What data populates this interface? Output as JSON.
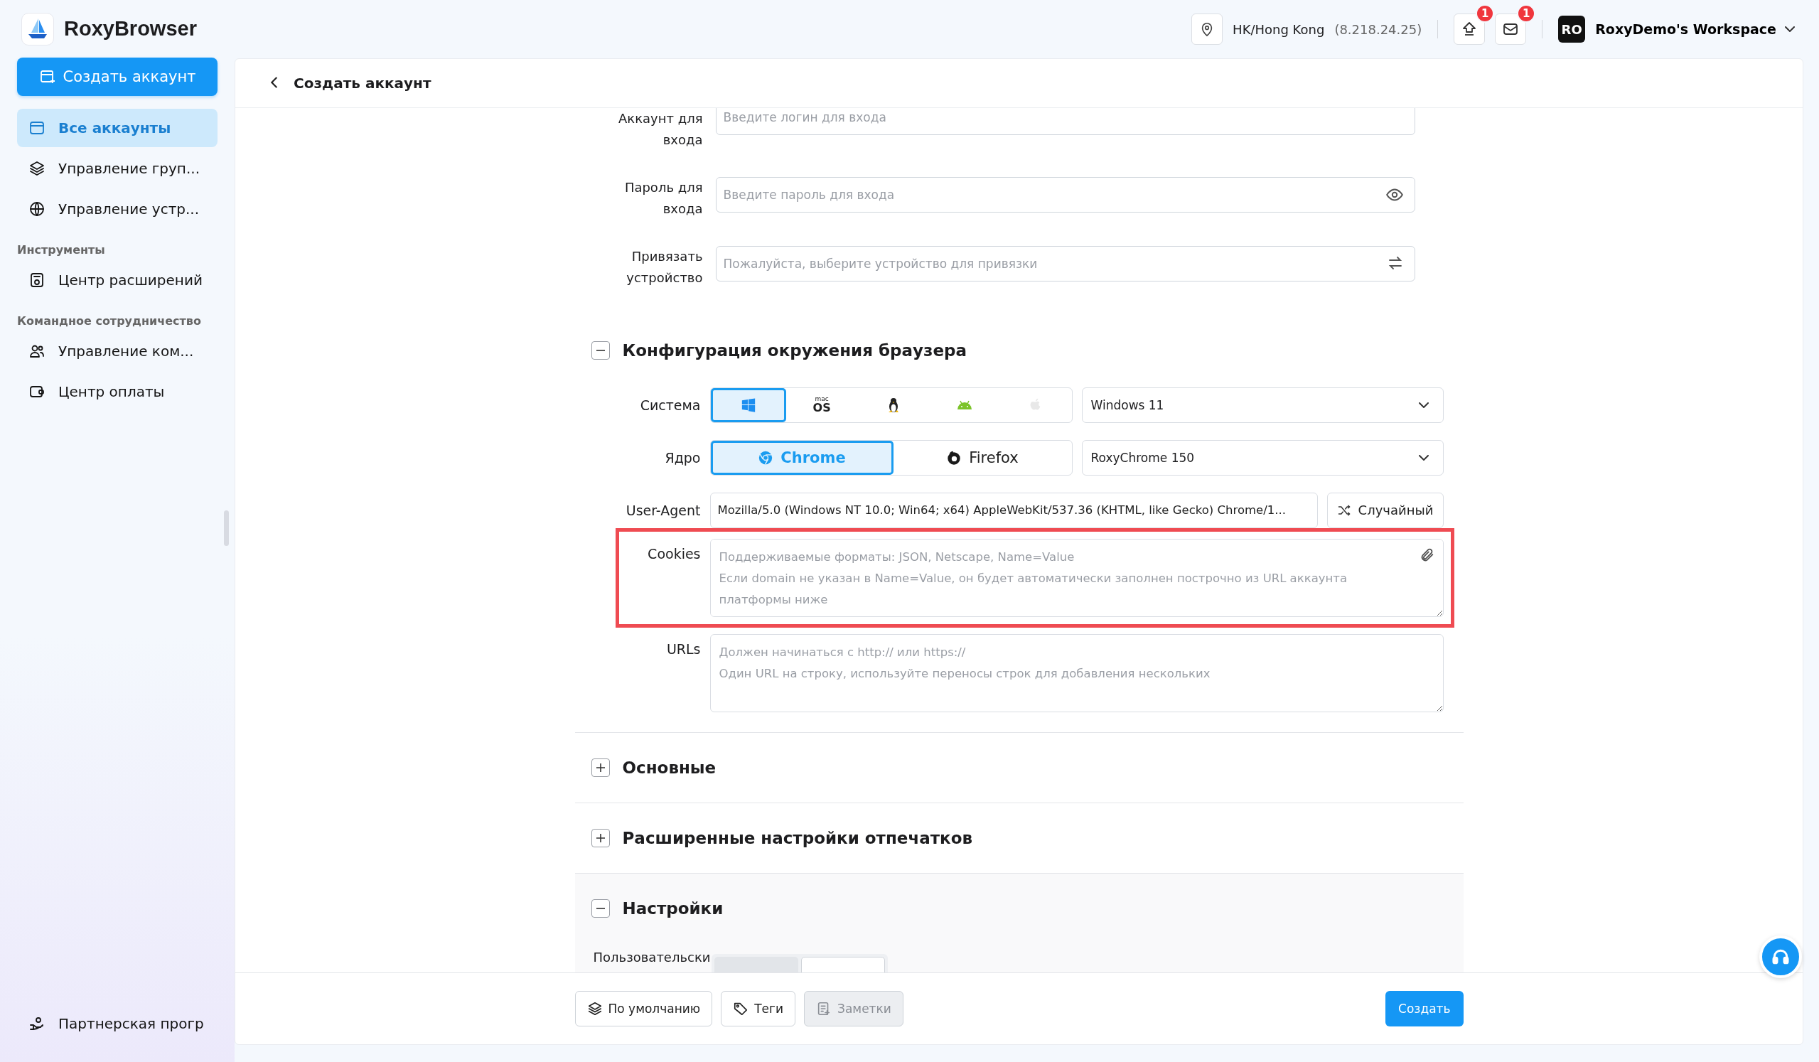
{
  "brand": {
    "name": "RoxyBrowser"
  },
  "sidebar": {
    "create_button": "Создать аккаунт",
    "sections": [
      {
        "items": [
          {
            "label": "Все аккаунты",
            "selected": true
          },
          {
            "label": "Управление груп...",
            "selected": false
          },
          {
            "label": "Управление устр...",
            "selected": false
          }
        ]
      },
      {
        "title": "Инструменты",
        "items": [
          {
            "label": "Центр расширений",
            "selected": false
          }
        ]
      },
      {
        "title": "Командное сотрудничество",
        "items": [
          {
            "label": "Управление ком...",
            "selected": false
          },
          {
            "label": "Центр оплаты",
            "selected": false
          }
        ]
      }
    ],
    "footer_item": {
      "label": "Партнерская прогр"
    }
  },
  "topbar": {
    "location": "HK/Hong Kong",
    "ip": "(8.218.24.25)",
    "upload_badge": "1",
    "mail_badge": "1",
    "workspace": {
      "avatar": "RO",
      "name": "RoxyDemo's Workspace"
    }
  },
  "page": {
    "title": "Создать аккаунт"
  },
  "account_fields": [
    {
      "label": "Аккаунт для входа",
      "placeholder": "Введите логин для входа",
      "kind": "text"
    },
    {
      "label": "Пароль для входа",
      "placeholder": "Введите пароль для входа",
      "kind": "password"
    },
    {
      "label": "Привязать устройство",
      "placeholder": "Пожалуйста, выберите устройство для привязки",
      "kind": "device"
    }
  ],
  "env": {
    "title": "Конфигурация окружения браузера",
    "expanded": true,
    "os_label": "Система",
    "os_options": [
      {
        "kind": "windows",
        "selected": true,
        "disabled": false
      },
      {
        "kind": "macos",
        "top": "mac",
        "bottom": "OS",
        "selected": false,
        "disabled": false
      },
      {
        "kind": "linux",
        "selected": false,
        "disabled": false
      },
      {
        "kind": "android",
        "selected": false,
        "disabled": false
      },
      {
        "kind": "apple",
        "selected": false,
        "disabled": true
      }
    ],
    "os_select": "Windows 11",
    "kernel_label": "Ядро",
    "kernel_options": [
      {
        "kind": "chrome",
        "label": "Chrome",
        "selected": true
      },
      {
        "kind": "firefox",
        "label": "Firefox",
        "selected": false
      }
    ],
    "kernel_select": "RoxyChrome 150",
    "ua_label": "User-Agent",
    "ua_value": "Mozilla/5.0 (Windows NT 10.0; Win64; x64) AppleWebKit/537.36 (KHTML, like Gecko) Chrome/1...",
    "random_button": "Случайный",
    "cookies": {
      "label": "Cookies",
      "placeholder": "Поддерживаемые форматы: JSON, Netscape, Name=Value\nЕсли domain не указан в Name=Value, он будет автоматически заполнен построчно из URL аккаунта платформы ниже",
      "highlighted": true
    },
    "urls": {
      "label": "URLs",
      "placeholder": "Должен начинаться с http:// или https://\nОдин URL на строку, используйте переносы строк для добавления нескольких",
      "highlighted": false
    }
  },
  "sections": [
    {
      "title": "Основные",
      "expanded": false,
      "hovered": false
    },
    {
      "title": "Расширенные настройки отпечатков",
      "expanded": false,
      "hovered": false
    },
    {
      "title": "Настройки",
      "expanded": true,
      "hovered": true
    }
  ],
  "settings_row": {
    "label": "Пользовательски",
    "options": [
      {
        "selected": false
      },
      {
        "selected": true
      }
    ]
  },
  "footer": {
    "buttons": [
      {
        "label": "По умолчанию",
        "disabled": false
      },
      {
        "label": "Теги",
        "disabled": false
      },
      {
        "label": "Заметки",
        "disabled": true
      }
    ],
    "create_button": "Создать"
  }
}
